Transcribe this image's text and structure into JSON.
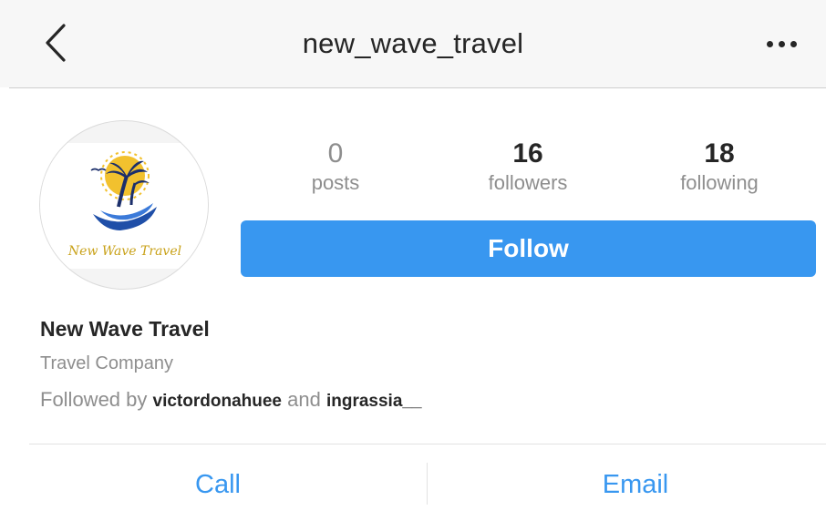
{
  "header": {
    "title": "new_wave_travel",
    "back_icon": "chevron-left-icon",
    "more_icon": "more-horizontal-icon"
  },
  "profile": {
    "avatar_logo_text": "New Wave Travel",
    "stats": [
      {
        "value": "0",
        "label": "posts"
      },
      {
        "value": "16",
        "label": "followers"
      },
      {
        "value": "18",
        "label": "following"
      }
    ],
    "follow_label": "Follow",
    "display_name": "New Wave Travel",
    "category": "Travel Company",
    "followed_by": {
      "prefix": "Followed by",
      "user1": "victordonahuee",
      "conjunction": "and",
      "user2": "ingrassia__"
    }
  },
  "contact": {
    "call_label": "Call",
    "email_label": "Email"
  },
  "colors": {
    "accent": "#3897f0",
    "text_primary": "#262626",
    "text_secondary": "#8e8e8e",
    "navbar_bg": "#f7f7f7",
    "logo_gold": "#c9a21a",
    "logo_blue": "#1f4fa8"
  }
}
